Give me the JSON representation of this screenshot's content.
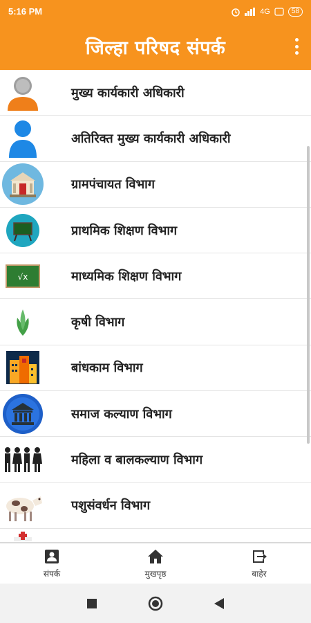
{
  "status": {
    "time": "5:16 PM",
    "network": "4G",
    "battery": "58"
  },
  "appbar": {
    "title": "जिल्हा परिषद संपर्क",
    "menu_icon": "more-vert-icon"
  },
  "list": {
    "items": [
      {
        "label": "मुख्य कार्यकारी अधिकारी",
        "icon": "ceo-person-icon"
      },
      {
        "label": "अतिरिक्त मुख्य कार्यकारी अधिकारी",
        "icon": "person-icon"
      },
      {
        "label": "ग्रामपंचायत विभाग",
        "icon": "gram-panchayat-building-icon"
      },
      {
        "label": "प्राथमिक शिक्षण विभाग",
        "icon": "blackboard-icon"
      },
      {
        "label": "माध्यमिक शिक्षण विभाग",
        "icon": "math-board-icon"
      },
      {
        "label": "कृषी विभाग",
        "icon": "crop-plant-icon"
      },
      {
        "label": "बांधकाम विभाग",
        "icon": "buildings-icon"
      },
      {
        "label": "समाज कल्याण विभाग",
        "icon": "institution-icon"
      },
      {
        "label": "महिला व बालकल्याण विभाग",
        "icon": "family-icon"
      },
      {
        "label": "पशुसंवर्धन विभाग",
        "icon": "cow-icon"
      }
    ]
  },
  "bottom_nav": {
    "items": [
      {
        "label": "संपर्क",
        "icon": "contacts-icon"
      },
      {
        "label": "मुखपृष्ठ",
        "icon": "home-icon"
      },
      {
        "label": "बाहेर",
        "icon": "exit-icon"
      }
    ]
  },
  "system_nav": {
    "recents_icon": "square-icon",
    "home_icon": "circle-icon",
    "back_icon": "triangle-back-icon"
  },
  "colors": {
    "accent": "#f7931e",
    "divider": "#e4e4e4"
  }
}
